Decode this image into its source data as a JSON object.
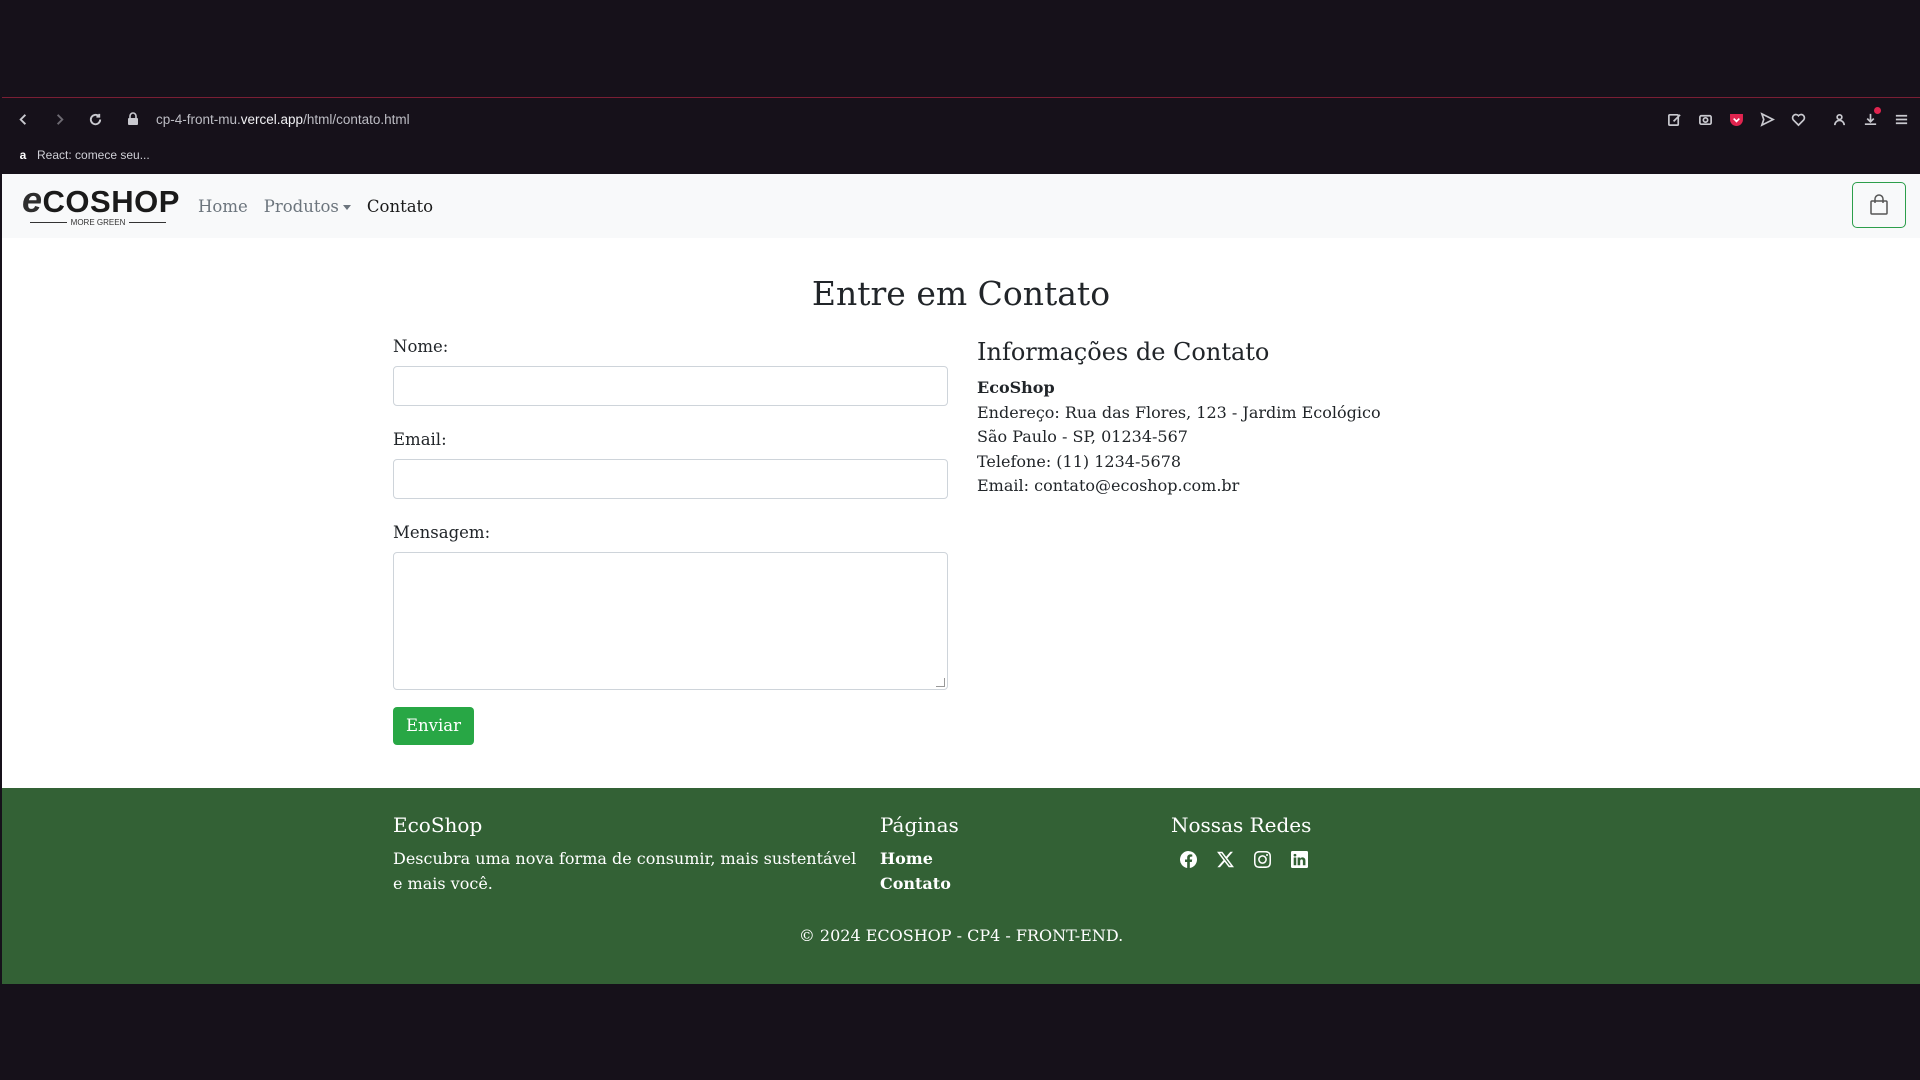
{
  "browser": {
    "url_prefix": "cp-4-front-mu.",
    "url_domain": "vercel.app",
    "url_path": "/html/contato.html",
    "bookmark": "React: comece seu..."
  },
  "navbar": {
    "logo_word": "COSHOP",
    "logo_initial": "e",
    "logo_tagline": "MORE GREEN",
    "links": [
      "Home",
      "Produtos",
      "Contato"
    ]
  },
  "main": {
    "title": "Entre em Contato",
    "form": {
      "name_label": "Nome:",
      "email_label": "Email:",
      "message_label": "Mensagem:",
      "submit_label": "Enviar"
    },
    "info": {
      "heading": "Informações de Contato",
      "company": "EcoShop",
      "address": "Endereço: Rua das Flores, 123 - Jardim Ecológico",
      "city": "São Paulo - SP, 01234-567",
      "phone": "Telefone: (11) 1234-5678",
      "email": "Email: contato@ecoshop.com.br"
    }
  },
  "footer": {
    "brand_heading": "EcoShop",
    "brand_text": "Descubra uma nova forma de consumir, mais sustentável e mais você.",
    "pages_heading": "Páginas",
    "pages_links": [
      "Home",
      "Contato"
    ],
    "social_heading": "Nossas Redes",
    "socials": [
      "facebook-icon",
      "x-icon",
      "instagram-icon",
      "linkedin-icon"
    ],
    "copyright": "© 2024 ECOSHOP - CP4 - FRONT-END."
  },
  "colors": {
    "footer_bg": "#336135",
    "button_green": "#28a745",
    "navbar_bg": "#f8f9fa",
    "browser_bg": "#16111a"
  }
}
